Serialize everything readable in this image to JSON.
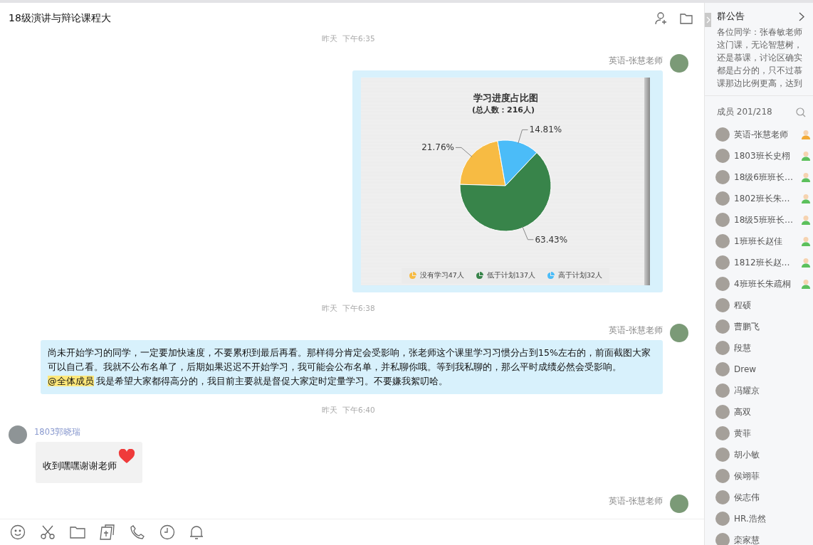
{
  "chat": {
    "title": "18级演讲与辩论课程大"
  },
  "messages": [
    {
      "kind": "time",
      "text": "昨天  下午6:35"
    },
    {
      "kind": "chart",
      "outgoing": true,
      "sender": "英语-张慧老师",
      "chart_subtitle": "(总人数：216人)",
      "chart_data": {
        "type": "pie",
        "title": "学习进度占比图",
        "categories": [
          "没有学习47人",
          "低于计划137人",
          "高于计划32人"
        ],
        "values": [
          21.76,
          63.43,
          14.81
        ],
        "colors": [
          "#f7bb43",
          "#38844a",
          "#4bbcf8"
        ],
        "value_labels": [
          "21.76%",
          "63.43%",
          "14.81%"
        ],
        "legend": "bottom"
      }
    },
    {
      "kind": "time",
      "text": "昨天  下午6:38"
    },
    {
      "kind": "text",
      "outgoing": true,
      "sender": "英语-张慧老师",
      "parts": [
        {
          "kind": "plain",
          "text": "尚未开始学习的同学，一定要加快速度，不要累积到最后再看。那样得分肯定会受影响，张老师这个课里学习习惯分占到15%左右的，前面截图大家可以自己看。我就不公布名单了，后期如果迟迟不开始学习，我可能会公布名单，并私聊你哦。等到我私聊的，那么平时成绩必然会受影响。"
        },
        {
          "kind": "mention",
          "text": "@全体成员"
        },
        {
          "kind": "plain",
          "text": " 我是希望大家都得高分的，我目前主要就是督促大家定时定量学习。不要嫌我絮叨哈。"
        }
      ]
    },
    {
      "kind": "time",
      "text": "昨天  下午6:40"
    },
    {
      "kind": "text",
      "outgoing": false,
      "sender": "1803郭晓瑞",
      "parts": [
        {
          "kind": "plain",
          "text": "收到嘿嘿谢谢老师"
        },
        {
          "kind": "heart"
        }
      ]
    },
    {
      "kind": "partial",
      "outgoing": true,
      "sender": "英语-张慧老师"
    }
  ],
  "notice": {
    "title": "群公告",
    "text": "各位同学：张春敏老师这门课，无论智慧树，还是慕课，讨论区确实都是占分的，只不过慕课那边比例更高，达到"
  },
  "members": {
    "label": "成员 201/218",
    "items": [
      {
        "name": "英语-张慧老师",
        "kind": "owner"
      },
      {
        "name": "1803班长史栩",
        "kind": "admin"
      },
      {
        "name": "18级6班班长…",
        "kind": "admin"
      },
      {
        "name": "1802班长朱…",
        "kind": "admin"
      },
      {
        "name": "18级5班班长…",
        "kind": "admin"
      },
      {
        "name": "1班班长赵佳",
        "kind": "admin"
      },
      {
        "name": "1812班长赵…",
        "kind": "admin"
      },
      {
        "name": "4班班长朱疏桐",
        "kind": "admin"
      },
      {
        "name": "程硕",
        "kind": "member"
      },
      {
        "name": "曹鹏飞",
        "kind": "member"
      },
      {
        "name": "段慧",
        "kind": "member"
      },
      {
        "name": "Drew",
        "kind": "member"
      },
      {
        "name": "冯耀京",
        "kind": "member"
      },
      {
        "name": "高双",
        "kind": "member"
      },
      {
        "name": "黄菲",
        "kind": "member"
      },
      {
        "name": "胡小敏",
        "kind": "member"
      },
      {
        "name": "侯翊菲",
        "kind": "member"
      },
      {
        "name": "侯志伟",
        "kind": "member"
      },
      {
        "name": "HR.浩然",
        "kind": "member"
      },
      {
        "name": "栾家慧",
        "kind": "member"
      }
    ]
  }
}
